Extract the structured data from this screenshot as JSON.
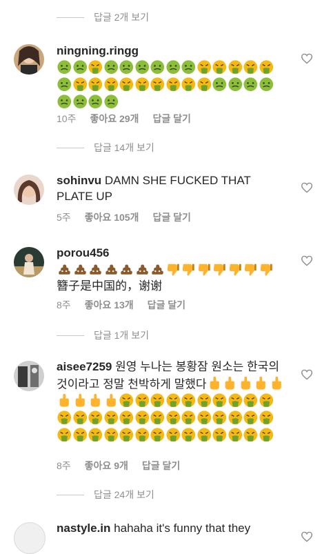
{
  "threads": {
    "t0": "답글 2개 보기",
    "t1": "답글 14개 보기",
    "t2": "답글 1개 보기",
    "t3": "답글 24개 보기"
  },
  "comments": [
    {
      "username": "ningning.ringg",
      "text": "",
      "emoji_sequence": [
        "sick",
        "sick",
        "vomit",
        "sick",
        "sick",
        "sick",
        "sick",
        "sick",
        "sick",
        "vomit",
        "vomit",
        "vomit",
        "vomit",
        "vomit",
        "sick",
        "vomit",
        "vomit",
        "vomit",
        "vomit",
        "vomit",
        "vomit",
        "vomit",
        "vomit",
        "vomit",
        "sick",
        "sick",
        "sick",
        "sick",
        "sick",
        "sick",
        "sick",
        "sick"
      ],
      "time": "10주",
      "likes": "좋아요 29개",
      "reply": "답글 달기"
    },
    {
      "username": "sohinvu",
      "text": "DAMN SHE FUCKED THAT PLATE UP",
      "time": "5주",
      "likes": "좋아요 105개",
      "reply": "답글 달기"
    },
    {
      "username": "porou456",
      "text": "簪子是中国的，谢谢",
      "emoji_sequence": [
        "poop",
        "poop",
        "poop",
        "poop",
        "poop",
        "poop",
        "poop",
        "thumbs-down",
        "thumbs-down",
        "thumbs-down",
        "thumbs-down",
        "thumbs-down",
        "thumbs-down",
        "thumbs-down"
      ],
      "time": "8주",
      "likes": "좋아요 13개",
      "reply": "답글 달기"
    },
    {
      "username": "aisee7259",
      "text": "원영 누나는 봉황잠 원소는 한국의 것이라고 정말 천박하게 말했다",
      "emoji_sequence": [
        "middle-finger",
        "middle-finger",
        "middle-finger",
        "middle-finger",
        "middle-finger",
        "middle-finger",
        "middle-finger",
        "middle-finger",
        "middle-finger",
        "vomit",
        "vomit",
        "vomit",
        "vomit",
        "vomit",
        "vomit",
        "vomit",
        "vomit",
        "vomit",
        "vomit",
        "vomit",
        "vomit",
        "vomit",
        "vomit",
        "vomit",
        "vomit",
        "vomit",
        "vomit",
        "vomit",
        "vomit",
        "vomit",
        "vomit",
        "vomit",
        "vomit",
        "vomit",
        "vomit",
        "vomit",
        "vomit",
        "vomit",
        "vomit",
        "vomit",
        "vomit",
        "vomit",
        "vomit",
        "vomit",
        "vomit",
        "vomit",
        "vomit"
      ],
      "time": "8주",
      "likes": "좋아요 9개",
      "reply": "답글 달기"
    },
    {
      "username": "nastyle.in",
      "text": "hahaha it's funny that they",
      "time": "",
      "likes": "",
      "reply": ""
    }
  ],
  "colors": {
    "sick_face": "#8bbf3a",
    "vomit_face": "#f5b915",
    "poop": "#8a5a2b",
    "hand": "#ffb32c",
    "text": "#262626",
    "meta": "#8e8e8e"
  }
}
